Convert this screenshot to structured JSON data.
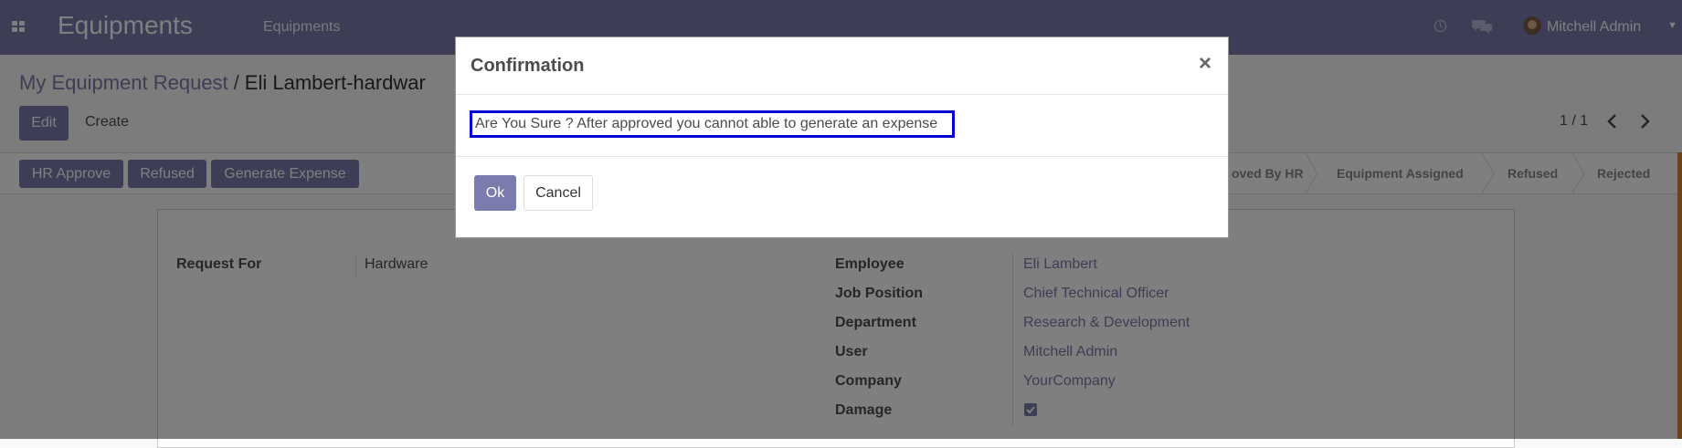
{
  "navbar": {
    "app_title": "Equipments",
    "menu_item": "Equipments",
    "user_name": "Mitchell Admin"
  },
  "control_panel": {
    "breadcrumb_parent": "My Equipment Request",
    "breadcrumb_separator": "/",
    "breadcrumb_current": "Eli Lambert-hardwar",
    "edit_label": "Edit",
    "create_label": "Create",
    "pager": "1 / 1"
  },
  "status_bar": {
    "buttons": [
      "HR Approve",
      "Refused",
      "Generate Expense"
    ],
    "stages": [
      "oved By HR",
      "Equipment Assigned",
      "Refused",
      "Rejected"
    ]
  },
  "form": {
    "request_for_label": "Request For",
    "request_for_value": "Hardware",
    "employee_label": "Employee",
    "employee_value": "Eli Lambert",
    "job_position_label": "Job Position",
    "job_position_value": "Chief Technical Officer",
    "department_label": "Department",
    "department_value": "Research & Development",
    "user_label": "User",
    "user_value": "Mitchell Admin",
    "company_label": "Company",
    "company_value": "YourCompany",
    "damage_label": "Damage",
    "damage_checked": true
  },
  "modal": {
    "title": "Confirmation",
    "close_glyph": "×",
    "message": "Are You Sure ? After approved you cannot able to generate an expense",
    "ok_label": "Ok",
    "cancel_label": "Cancel"
  },
  "colors": {
    "brand": "#7c7bad",
    "highlight_border": "#0000d6"
  }
}
